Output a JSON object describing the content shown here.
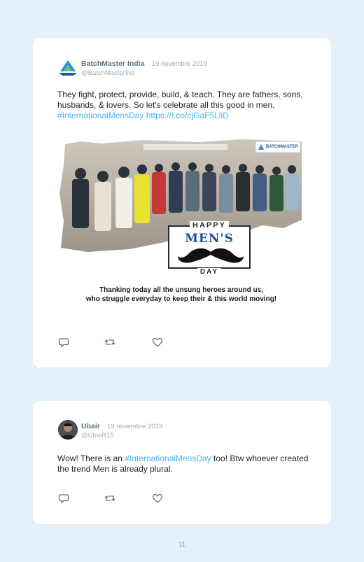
{
  "tweets": [
    {
      "author": "BatchMaster India",
      "date": "· 19 novembre 2019",
      "handle": "@BatchMasterInd",
      "text_part1": "They fight, protect, provide, build, & teach. They are fathers, sons, husbands, & lovers. So let's celebrate all this good in men. ",
      "hashtag": "#InternationalMensDay",
      "link": "https://t.co/cjGaF5LliD",
      "media": {
        "brand": "BATCHMASTER",
        "happy": "HAPPY",
        "mens": "MEN'S",
        "day": "DAY",
        "line1": "Thanking today all the unsung heroes around us,",
        "line2": "who struggle everyday to keep their & this world moving!"
      }
    },
    {
      "author": "Ubair",
      "date": "· 19 novembre 2019",
      "handle": "@UbaiR15",
      "text_part1": "Wow! There is an ",
      "hashtag": "#InternationalMensDay",
      "text_part2": " too! Btw whoever created the trend Men is already plural."
    }
  ],
  "icons": [
    "reply-icon",
    "retweet-icon",
    "like-icon",
    "batchmaster-logo-icon",
    "mustache-icon"
  ],
  "colors": {
    "background": "#e6f0f8",
    "link": "#4ab3f4",
    "name": "#5c7285",
    "brand": "#1e4f96"
  },
  "page_number": "11"
}
